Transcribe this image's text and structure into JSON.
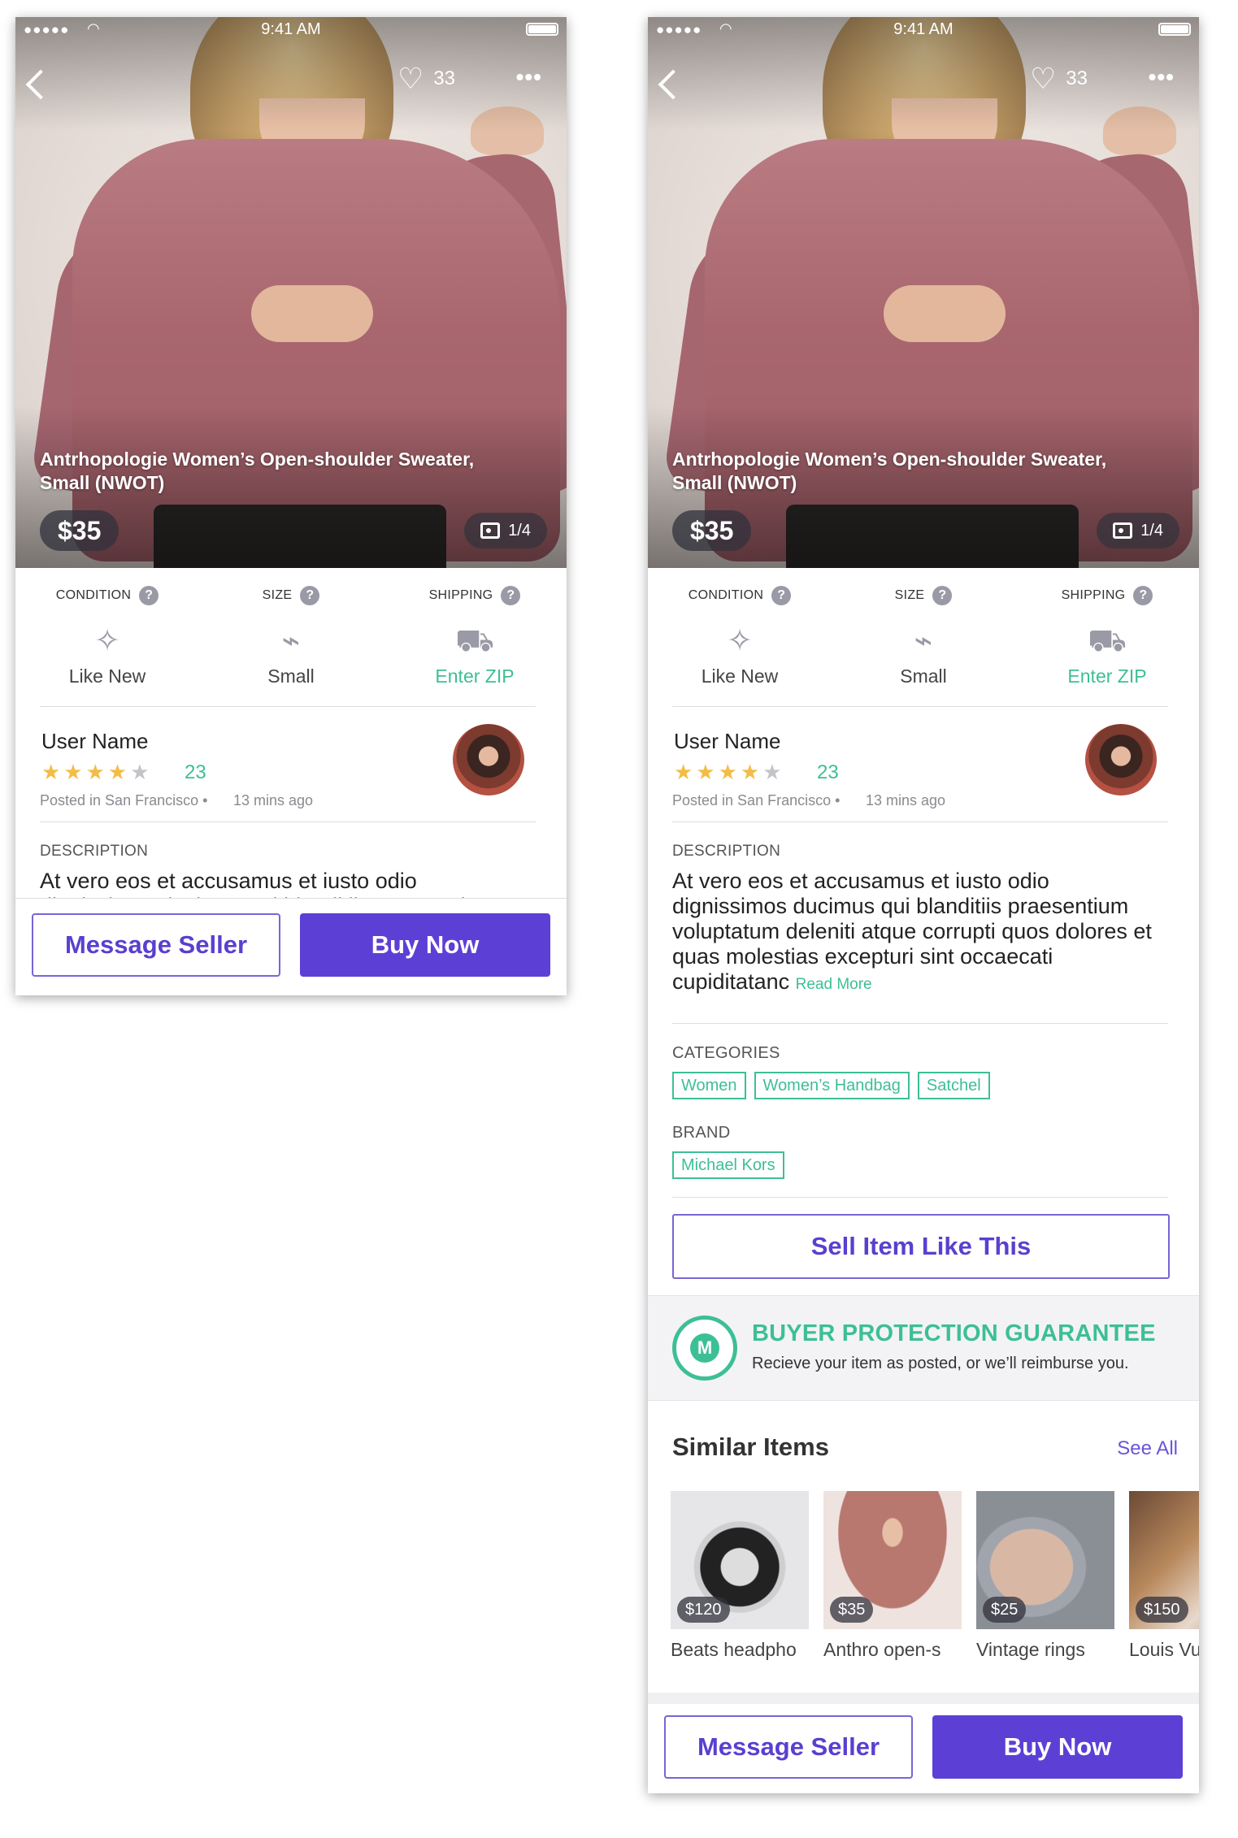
{
  "status": {
    "time": "9:41 AM"
  },
  "listing": {
    "likes": "33",
    "title": "Antrhopologie Women’s Open-shoulder  Sweater, Small (NWOT)",
    "price": "$35",
    "photo_count": "1/4"
  },
  "attributes": {
    "condition": {
      "label": "CONDITION",
      "value": "Like New",
      "icon": "sparkle-icon"
    },
    "size": {
      "label": "SIZE",
      "value": "Small",
      "icon": "tag-icon"
    },
    "shipping": {
      "label": "SHIPPING",
      "value": "Enter ZIP",
      "icon": "truck-icon"
    },
    "help_glyph": "?"
  },
  "seller": {
    "name": "User Name",
    "rating": 4,
    "rating_count": "23",
    "location": "Posted in San Francisco",
    "posted_ago": "13 mins ago"
  },
  "description": {
    "label": "DESCRIPTION",
    "text_short": "At vero eos et accusamus et iusto odio",
    "text_full": "At vero eos et accusamus et iusto odio dignissimos ducimus qui blanditiis praesentium voluptatum deleniti atque corrupti quos dolores et quas molestias excepturi sint occaecati cupiditatanc",
    "read_more": "Read More"
  },
  "categories": {
    "label": "CATEGORIES",
    "items": [
      "Women",
      "Women’s Handbag",
      "Satchel"
    ]
  },
  "brand": {
    "label": "BRAND",
    "items": [
      "Michael Kors"
    ]
  },
  "sell_button": "Sell Item Like This",
  "guarantee": {
    "title": "BUYER PROTECTION GUARANTEE",
    "subtitle": "Recieve your item as posted, or we’ll reimburse you.",
    "badge_letter": "M"
  },
  "similar": {
    "title": "Similar Items",
    "see_all": "See All",
    "items": [
      {
        "name": "Beats headpho",
        "price": "$120"
      },
      {
        "name": "Anthro open-s",
        "price": "$35"
      },
      {
        "name": "Vintage rings",
        "price": "$25"
      },
      {
        "name": "Louis Vu",
        "price": "$150"
      }
    ]
  },
  "actions": {
    "message": "Message Seller",
    "buy": "Buy Now"
  },
  "colors": {
    "accent": "#5c40d6",
    "green": "#3dbf96",
    "star": "#f2bd47"
  }
}
